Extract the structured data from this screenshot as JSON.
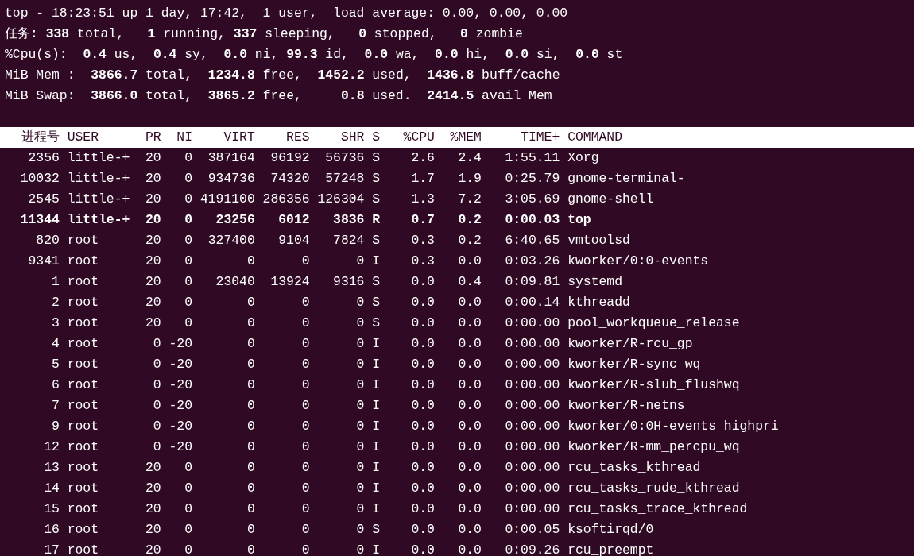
{
  "summary": [
    "top - 18:23:51 up 1 day, 17:42,  1 user,  load average: 0.00, 0.00, 0.00",
    "任务: **338** total,   **1** running, **337** sleeping,   **0** stopped,   **0** zombie",
    "%Cpu(s):  **0.4** us,  **0.4** sy,  **0.0** ni, **99.3** id,  **0.0** wa,  **0.0** hi,  **0.0** si,  **0.0** st",
    "MiB Mem :  **3866.7** total,  **1234.8** free,  **1452.2** used,  **1436.8** buff/cache",
    "MiB Swap:  **3866.0** total,  **3865.2** free,     **0.8** used.  **2414.5** avail Mem"
  ],
  "table": {
    "columns": [
      "进程号",
      "USER",
      "PR",
      "NI",
      "VIRT",
      "RES",
      "SHR",
      "S",
      "%CPU",
      "%MEM",
      "TIME+",
      "COMMAND"
    ],
    "rows": [
      {
        "bold": false,
        "cells": [
          "2356",
          "little-+",
          "20",
          "0",
          "387164",
          "96192",
          "56736",
          "S",
          "2.6",
          "2.4",
          "1:55.11",
          "Xorg"
        ]
      },
      {
        "bold": false,
        "cells": [
          "10032",
          "little-+",
          "20",
          "0",
          "934736",
          "74320",
          "57248",
          "S",
          "1.7",
          "1.9",
          "0:25.79",
          "gnome-terminal-"
        ]
      },
      {
        "bold": false,
        "cells": [
          "2545",
          "little-+",
          "20",
          "0",
          "4191100",
          "286356",
          "126304",
          "S",
          "1.3",
          "7.2",
          "3:05.69",
          "gnome-shell"
        ]
      },
      {
        "bold": true,
        "cells": [
          "11344",
          "little-+",
          "20",
          "0",
          "23256",
          "6012",
          "3836",
          "R",
          "0.7",
          "0.2",
          "0:00.03",
          "top"
        ]
      },
      {
        "bold": false,
        "cells": [
          "820",
          "root",
          "20",
          "0",
          "327400",
          "9104",
          "7824",
          "S",
          "0.3",
          "0.2",
          "6:40.65",
          "vmtoolsd"
        ]
      },
      {
        "bold": false,
        "cells": [
          "9341",
          "root",
          "20",
          "0",
          "0",
          "0",
          "0",
          "I",
          "0.3",
          "0.0",
          "0:03.26",
          "kworker/0:0-events"
        ]
      },
      {
        "bold": false,
        "cells": [
          "1",
          "root",
          "20",
          "0",
          "23040",
          "13924",
          "9316",
          "S",
          "0.0",
          "0.4",
          "0:09.81",
          "systemd"
        ]
      },
      {
        "bold": false,
        "cells": [
          "2",
          "root",
          "20",
          "0",
          "0",
          "0",
          "0",
          "S",
          "0.0",
          "0.0",
          "0:00.14",
          "kthreadd"
        ]
      },
      {
        "bold": false,
        "cells": [
          "3",
          "root",
          "20",
          "0",
          "0",
          "0",
          "0",
          "S",
          "0.0",
          "0.0",
          "0:00.00",
          "pool_workqueue_release"
        ]
      },
      {
        "bold": false,
        "cells": [
          "4",
          "root",
          "0",
          "-20",
          "0",
          "0",
          "0",
          "I",
          "0.0",
          "0.0",
          "0:00.00",
          "kworker/R-rcu_gp"
        ]
      },
      {
        "bold": false,
        "cells": [
          "5",
          "root",
          "0",
          "-20",
          "0",
          "0",
          "0",
          "I",
          "0.0",
          "0.0",
          "0:00.00",
          "kworker/R-sync_wq"
        ]
      },
      {
        "bold": false,
        "cells": [
          "6",
          "root",
          "0",
          "-20",
          "0",
          "0",
          "0",
          "I",
          "0.0",
          "0.0",
          "0:00.00",
          "kworker/R-slub_flushwq"
        ]
      },
      {
        "bold": false,
        "cells": [
          "7",
          "root",
          "0",
          "-20",
          "0",
          "0",
          "0",
          "I",
          "0.0",
          "0.0",
          "0:00.00",
          "kworker/R-netns"
        ]
      },
      {
        "bold": false,
        "cells": [
          "9",
          "root",
          "0",
          "-20",
          "0",
          "0",
          "0",
          "I",
          "0.0",
          "0.0",
          "0:00.00",
          "kworker/0:0H-events_highpri"
        ]
      },
      {
        "bold": false,
        "cells": [
          "12",
          "root",
          "0",
          "-20",
          "0",
          "0",
          "0",
          "I",
          "0.0",
          "0.0",
          "0:00.00",
          "kworker/R-mm_percpu_wq"
        ]
      },
      {
        "bold": false,
        "cells": [
          "13",
          "root",
          "20",
          "0",
          "0",
          "0",
          "0",
          "I",
          "0.0",
          "0.0",
          "0:00.00",
          "rcu_tasks_kthread"
        ]
      },
      {
        "bold": false,
        "cells": [
          "14",
          "root",
          "20",
          "0",
          "0",
          "0",
          "0",
          "I",
          "0.0",
          "0.0",
          "0:00.00",
          "rcu_tasks_rude_kthread"
        ]
      },
      {
        "bold": false,
        "cells": [
          "15",
          "root",
          "20",
          "0",
          "0",
          "0",
          "0",
          "I",
          "0.0",
          "0.0",
          "0:00.00",
          "rcu_tasks_trace_kthread"
        ]
      },
      {
        "bold": false,
        "cells": [
          "16",
          "root",
          "20",
          "0",
          "0",
          "0",
          "0",
          "S",
          "0.0",
          "0.0",
          "0:00.05",
          "ksoftirqd/0"
        ]
      },
      {
        "bold": false,
        "cells": [
          "17",
          "root",
          "20",
          "0",
          "0",
          "0",
          "0",
          "I",
          "0.0",
          "0.0",
          "0:09.26",
          "rcu_preempt"
        ]
      }
    ]
  }
}
